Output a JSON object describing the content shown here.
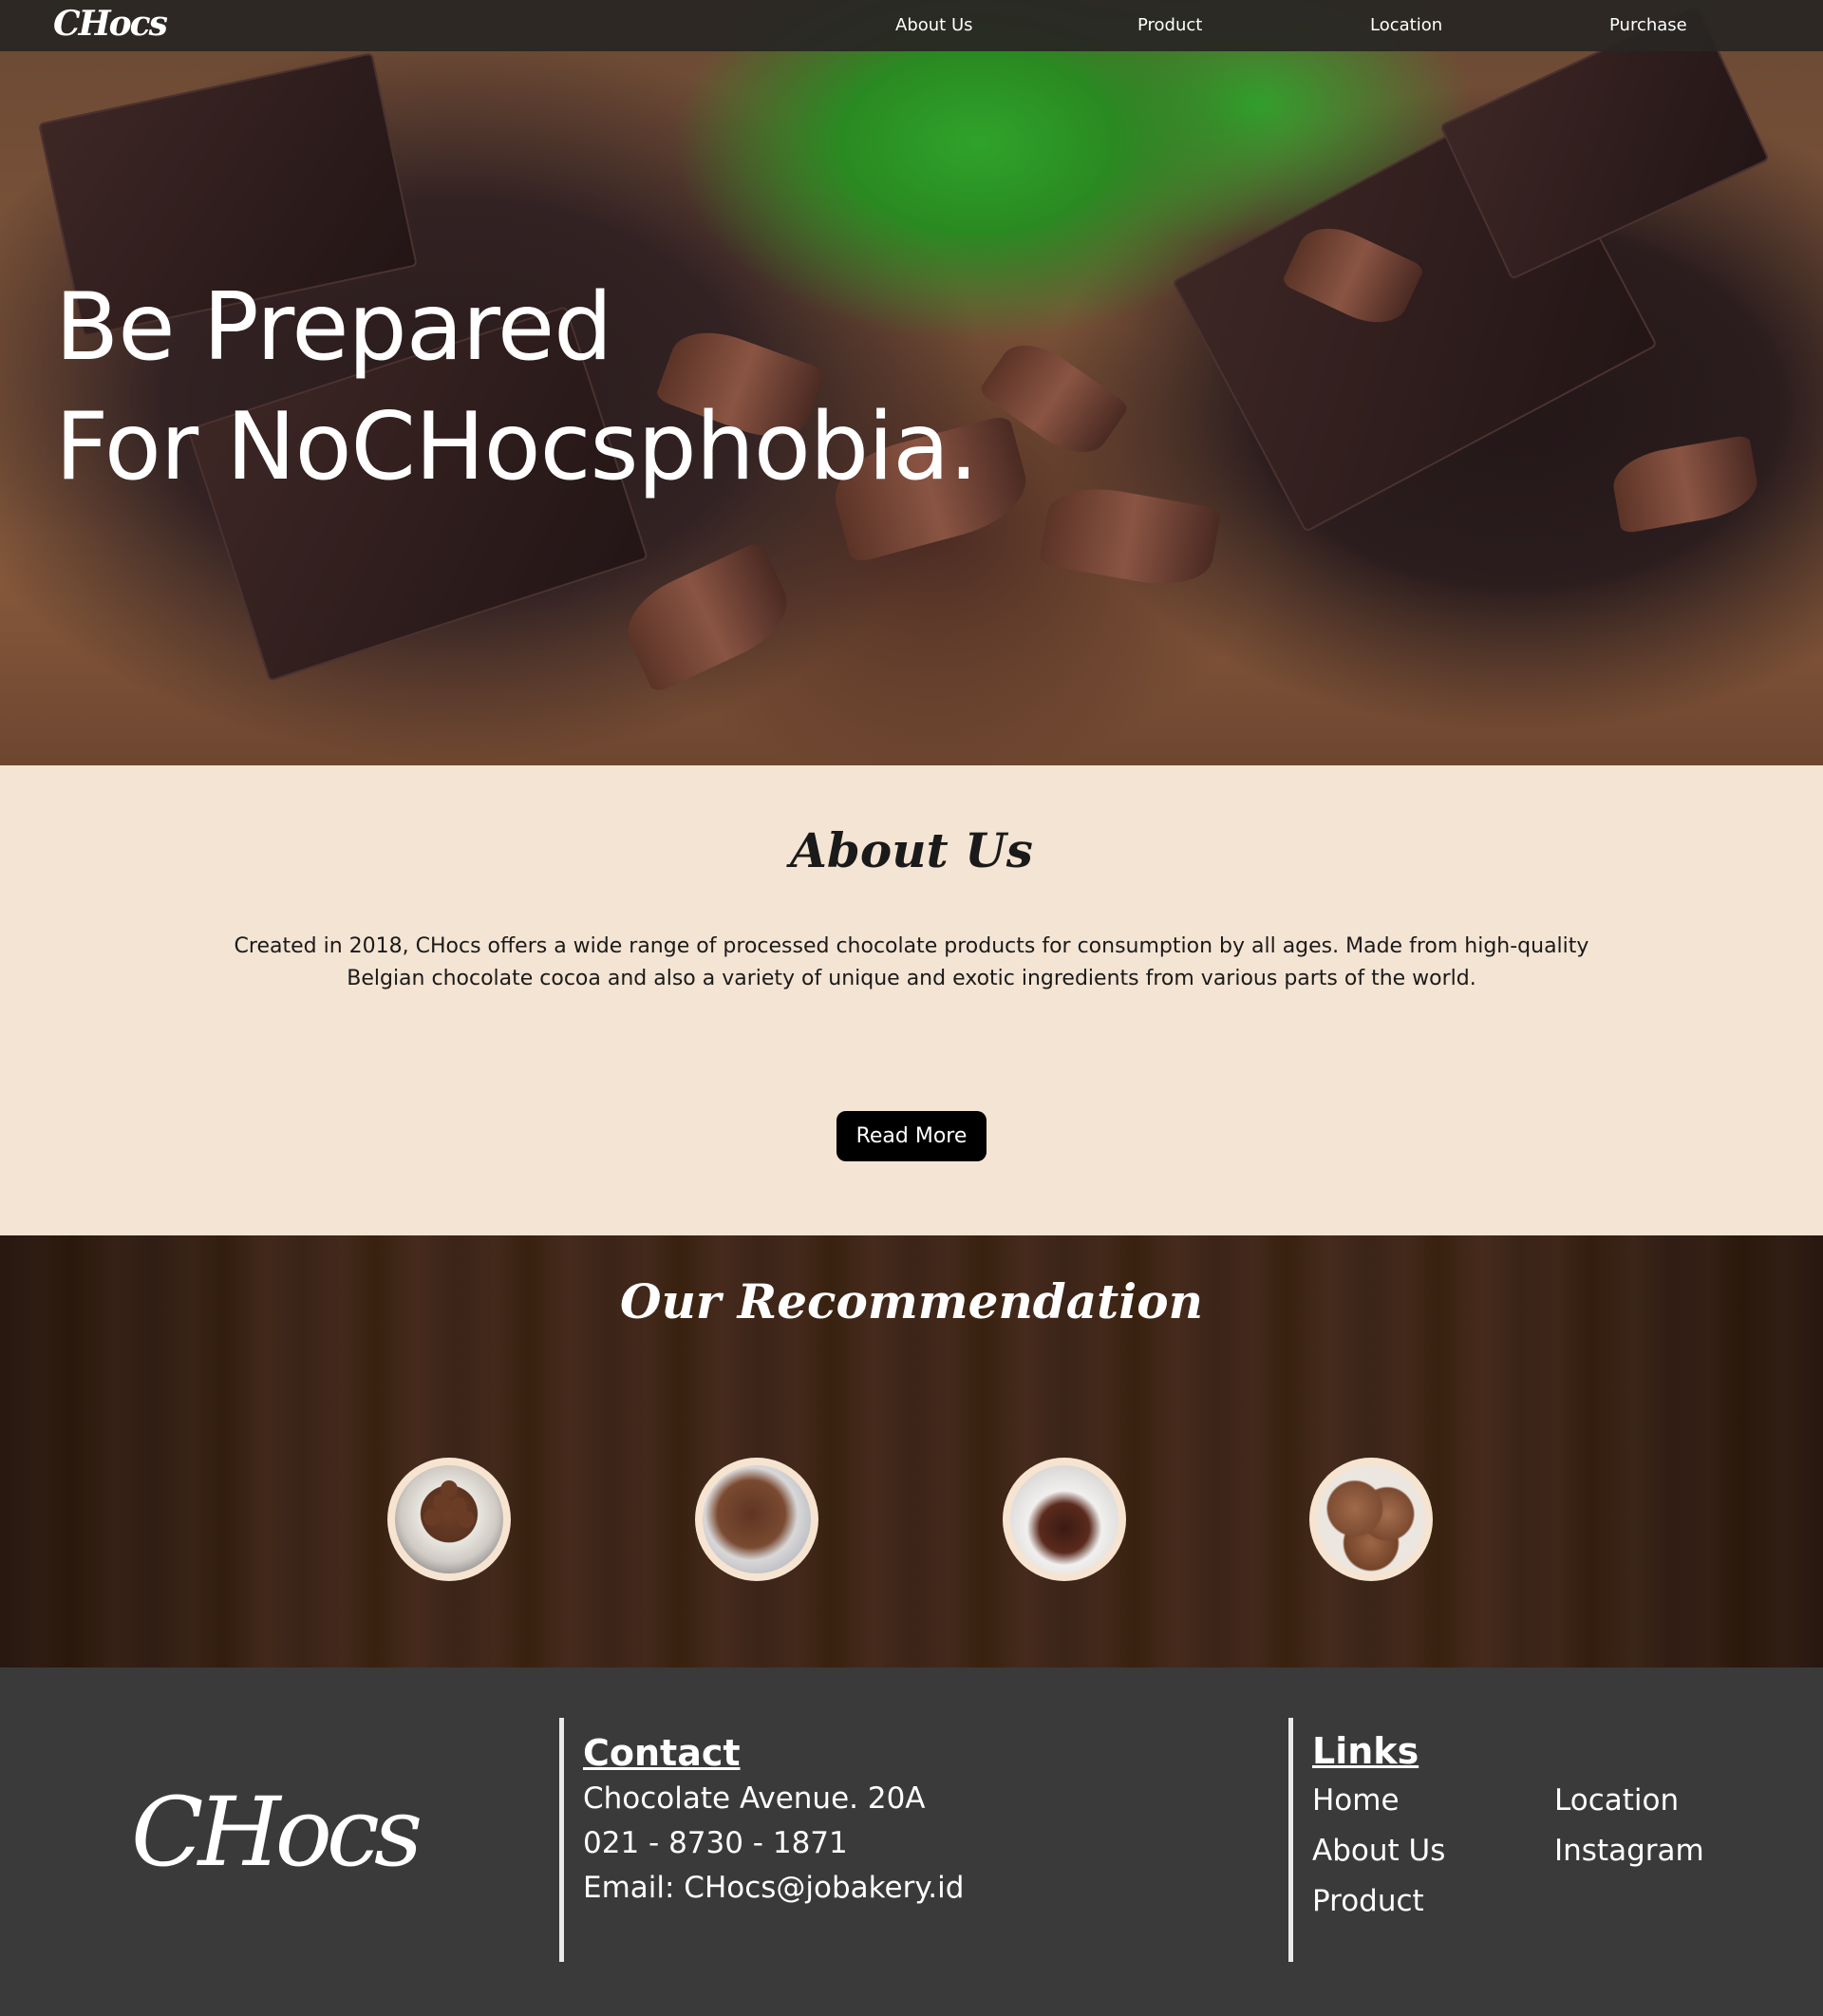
{
  "nav": {
    "logo": "CHocs",
    "items": [
      {
        "label": "About Us"
      },
      {
        "label": "Product"
      },
      {
        "label": "Location"
      },
      {
        "label": "Purchase"
      }
    ]
  },
  "hero": {
    "title_line1": "Be Prepared",
    "title_line2": "For NoCHocsphobia."
  },
  "about": {
    "heading": "About Us",
    "text": "Created in 2018, CHocs offers a wide range of processed chocolate products for consumption by all ages. Made from high-quality Belgian chocolate cocoa and also a variety of unique and exotic ingredients from various parts of the world.",
    "button": "Read More"
  },
  "recommendation": {
    "heading": "Our Recommendation"
  },
  "footer": {
    "logo": "CHocs",
    "contact": {
      "heading": "Contact",
      "address": "Chocolate Avenue. 20A",
      "phone": "021 - 8730 - 1871",
      "email": "Email: CHocs@jobakery.id"
    },
    "links": {
      "heading": "Links",
      "items": [
        "Home",
        "About Us",
        "Product",
        "Location",
        "Instagram"
      ]
    }
  },
  "colors": {
    "nav_bg": "#282624",
    "about_bg": "#f4e4d3",
    "footer_bg": "#3a3a3a",
    "button_bg": "#000000"
  }
}
